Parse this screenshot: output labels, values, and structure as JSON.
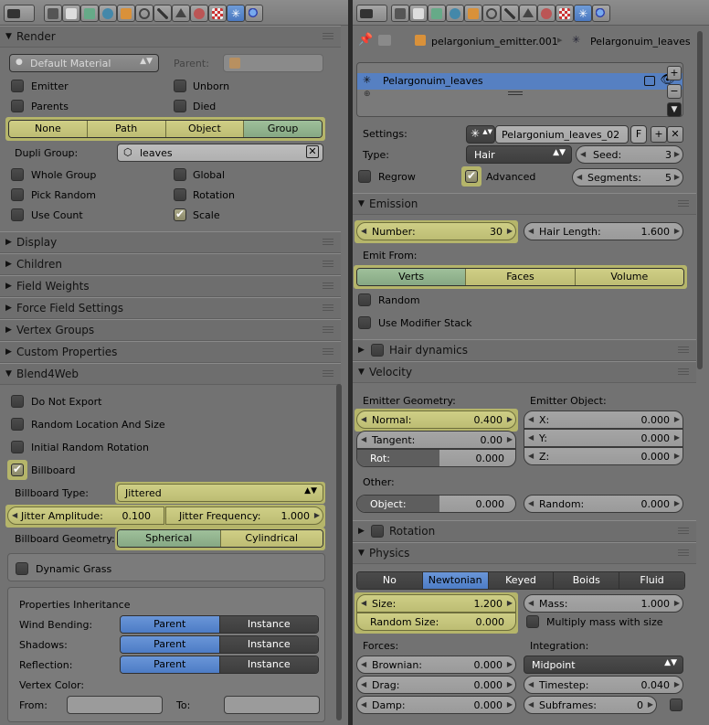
{
  "left": {
    "render": {
      "title": "Render",
      "material": "Default Material",
      "parent_label": "Parent:",
      "emitter": "Emitter",
      "unborn": "Unborn",
      "parents": "Parents",
      "died": "Died",
      "modes": [
        "None",
        "Path",
        "Object",
        "Group"
      ],
      "dupli_group_label": "Dupli Group:",
      "dupli_group_value": "leaves",
      "whole_group": "Whole Group",
      "global": "Global",
      "pick_random": "Pick Random",
      "rotation": "Rotation",
      "use_count": "Use Count",
      "scale": "Scale"
    },
    "collapsed": [
      "Display",
      "Children",
      "Field Weights",
      "Force Field Settings",
      "Vertex Groups",
      "Custom Properties"
    ],
    "b4w": {
      "title": "Blend4Web",
      "do_not_export": "Do Not Export",
      "random_loc": "Random Location And Size",
      "initial_rot": "Initial Random Rotation",
      "billboard": "Billboard",
      "billboard_type_label": "Billboard Type:",
      "billboard_type": "Jittered",
      "jitter_amp_label": "Jitter Amplitude:",
      "jitter_amp": "0.100",
      "jitter_freq_label": "Jitter Frequency:",
      "jitter_freq": "1.000",
      "geom_label": "Billboard Geometry:",
      "geom": [
        "Spherical",
        "Cylindrical"
      ],
      "dynamic_grass": "Dynamic Grass",
      "inherit_title": "Properties Inheritance",
      "inherit_rows": [
        {
          "label": "Wind Bending:",
          "opts": [
            "Parent",
            "Instance"
          ]
        },
        {
          "label": "Shadows:",
          "opts": [
            "Parent",
            "Instance"
          ]
        },
        {
          "label": "Reflection:",
          "opts": [
            "Parent",
            "Instance"
          ]
        }
      ],
      "vertex_color": "Vertex Color:",
      "from": "From:",
      "to": "To:"
    }
  },
  "right": {
    "breadcrumb": {
      "object": "pelargonium_emitter.001",
      "psys": "Pelargonuim_leaves"
    },
    "list_item": "Pelargonuim_leaves",
    "settings_label": "Settings:",
    "settings_value": "Pelargonium_leaves_02",
    "fake_user": "F",
    "type_label": "Type:",
    "type_value": "Hair",
    "seed_label": "Seed:",
    "seed_value": "3",
    "regrow": "Regrow",
    "advanced": "Advanced",
    "segments_label": "Segments:",
    "segments_value": "5",
    "emission": {
      "title": "Emission",
      "number_label": "Number:",
      "number_value": "30",
      "hair_len_label": "Hair Length:",
      "hair_len_value": "1.600",
      "emit_from": "Emit From:",
      "modes": [
        "Verts",
        "Faces",
        "Volume"
      ],
      "random": "Random",
      "use_mod": "Use Modifier Stack"
    },
    "hair_dynamics": "Hair dynamics",
    "velocity": {
      "title": "Velocity",
      "emitter_geom": "Emitter Geometry:",
      "emitter_obj": "Emitter Object:",
      "normal_label": "Normal:",
      "normal": "0.400",
      "tangent_label": "Tangent:",
      "tangent": "0.00",
      "rot_label": "Rot:",
      "rot": "0.000",
      "x_label": "X:",
      "x": "0.000",
      "y_label": "Y:",
      "y": "0.000",
      "z_label": "Z:",
      "z": "0.000",
      "other": "Other:",
      "object_label": "Object:",
      "object": "0.000",
      "random_label": "Random:",
      "random": "0.000"
    },
    "rotation": "Rotation",
    "physics": {
      "title": "Physics",
      "modes": [
        "No",
        "Newtonian",
        "Keyed",
        "Boids",
        "Fluid"
      ],
      "size_label": "Size:",
      "size": "1.200",
      "rsize_label": "Random Size:",
      "rsize": "0.000",
      "mass_label": "Mass:",
      "mass": "1.000",
      "mult_mass": "Multiply mass with size",
      "forces": "Forces:",
      "integration": "Integration:",
      "brownian_label": "Brownian:",
      "brownian": "0.000",
      "drag_label": "Drag:",
      "drag": "0.000",
      "damp_label": "Damp:",
      "damp": "0.000",
      "integrator": "Midpoint",
      "timestep_label": "Timestep:",
      "timestep": "0.040",
      "subframes_label": "Subframes:",
      "subframes": "0"
    }
  }
}
